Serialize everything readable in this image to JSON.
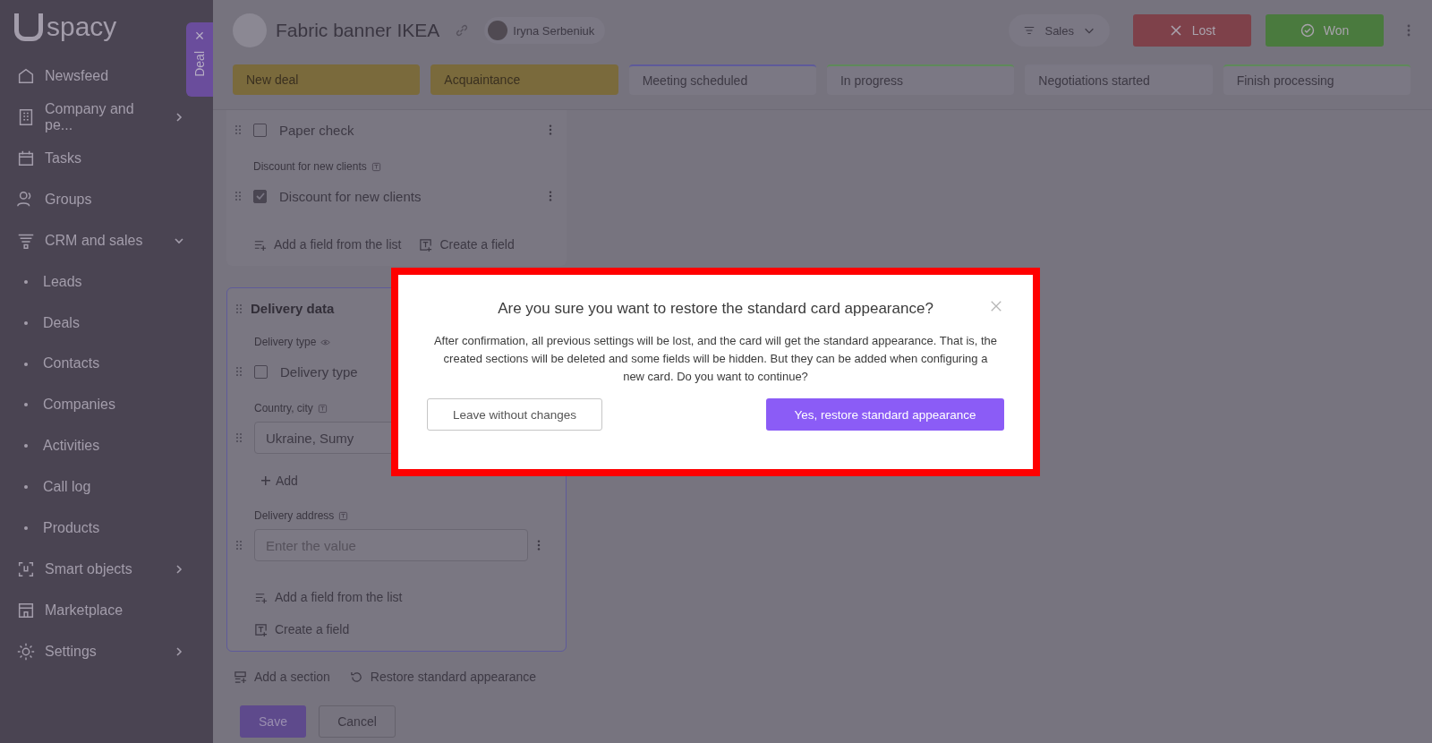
{
  "logo": "spacy",
  "deal_tab": {
    "label": "Deal",
    "close": "×"
  },
  "sidebar": {
    "items": [
      {
        "kind": "main",
        "label": "Newsfeed"
      },
      {
        "kind": "main",
        "label": "Company and pe...",
        "expanded": false
      },
      {
        "kind": "main",
        "label": "Tasks"
      },
      {
        "kind": "main",
        "label": "Groups"
      },
      {
        "kind": "main",
        "label": "CRM and sales",
        "expanded": true
      },
      {
        "kind": "sub",
        "label": "Leads"
      },
      {
        "kind": "sub",
        "label": "Deals"
      },
      {
        "kind": "sub",
        "label": "Contacts"
      },
      {
        "kind": "sub",
        "label": "Companies"
      },
      {
        "kind": "sub",
        "label": "Activities"
      },
      {
        "kind": "sub",
        "label": "Call log"
      },
      {
        "kind": "sub",
        "label": "Products"
      },
      {
        "kind": "main",
        "label": "Smart objects",
        "expanded": false
      },
      {
        "kind": "main",
        "label": "Marketplace"
      },
      {
        "kind": "main",
        "label": "Settings",
        "expanded": false
      }
    ]
  },
  "header": {
    "title": "Fabric banner IKEA",
    "owner": "Iryna Serbeniuk",
    "pipeline": "Sales",
    "lost": "Lost",
    "won": "Won"
  },
  "stages": [
    {
      "label": "New deal",
      "reached": true,
      "color": "#7a6a3c"
    },
    {
      "label": "Acquaintance",
      "reached": true,
      "color": "#7a6a3c"
    },
    {
      "label": "Meeting scheduled",
      "reached": false,
      "color": "#5e5a9a"
    },
    {
      "label": "In progress",
      "reached": false,
      "color": "#5f8a5a"
    },
    {
      "label": "Negotiations started",
      "reached": false,
      "color": "#7a7784"
    },
    {
      "label": "Finish processing",
      "reached": false,
      "color": "#5f8a5a"
    }
  ],
  "sections": [
    {
      "fields": [
        {
          "kind": "checkbox",
          "label": "Paper check",
          "checked": false
        },
        {
          "kind": "label",
          "label": "Discount for new clients"
        },
        {
          "kind": "checkbox",
          "label": "Discount for new clients",
          "checked": true
        }
      ],
      "actions": [
        "Add a field from the list",
        "Create a field"
      ]
    },
    {
      "title": "Delivery data",
      "fields": [
        {
          "kind": "visibility",
          "label": "Delivery type"
        },
        {
          "kind": "checkbox",
          "label": "Delivery type",
          "checked": false
        },
        {
          "kind": "label",
          "label": "Country, city"
        },
        {
          "kind": "input",
          "value": "Ukraine, Sumy"
        },
        {
          "kind": "add",
          "label": "Add"
        },
        {
          "kind": "label",
          "label": "Delivery address"
        },
        {
          "kind": "input",
          "placeholder": "Enter the value"
        }
      ],
      "actions": [
        "Add a field from the list",
        "Create a field"
      ]
    }
  ],
  "footer_links": [
    "Add a section",
    "Restore standard appearance"
  ],
  "save": "Save",
  "cancel": "Cancel",
  "dialog": {
    "title": "Are you sure you want to restore the standard card appearance?",
    "text": "After confirmation, all previous settings will be lost, and the card will get the standard appearance. That is, the created sections will be deleted and some fields will be hidden. But they can be added when configuring a new card. Do you want to continue?",
    "cancel": "Leave without changes",
    "confirm": "Yes, restore standard appearance"
  }
}
